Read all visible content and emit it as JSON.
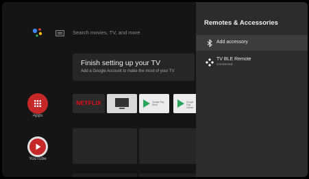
{
  "home": {
    "assistant_icon": "google-assistant-icon",
    "keyboard_icon": "keyboard-icon",
    "search_placeholder": "Search movies, TV, and more",
    "setup_card": {
      "title": "Finish setting up your TV",
      "subtitle": "Add a Google Account to make the most of your TV"
    },
    "apps": [
      {
        "label": "Apps",
        "icon": "apps-grid-icon",
        "color": "#c62828"
      },
      {
        "label": "YouTube",
        "icon": "youtube-icon",
        "color": "#c62828"
      }
    ],
    "tiles": [
      {
        "name": "netflix",
        "text": "NETFLIX"
      },
      {
        "name": "live-tv",
        "icon": "tv-icon"
      },
      {
        "name": "google-play-store",
        "icon": "google-play-icon",
        "text": "Google Play Store"
      },
      {
        "name": "google-play-games",
        "icon": "google-play-icon",
        "text": "Google Play Games"
      }
    ]
  },
  "panel": {
    "title": "Remotes & Accessories",
    "items": [
      {
        "label": "Add accessory",
        "icon": "bluetooth-icon",
        "selected": true
      },
      {
        "label": "TV BLE Remote",
        "status": "Connected",
        "icon": "gamepad-icon"
      }
    ]
  },
  "colors": {
    "panel_bg": "#2c2c2c",
    "selected_row": "#3c3c3c",
    "netflix_red": "#e50914",
    "youtube_red": "#c62828"
  }
}
